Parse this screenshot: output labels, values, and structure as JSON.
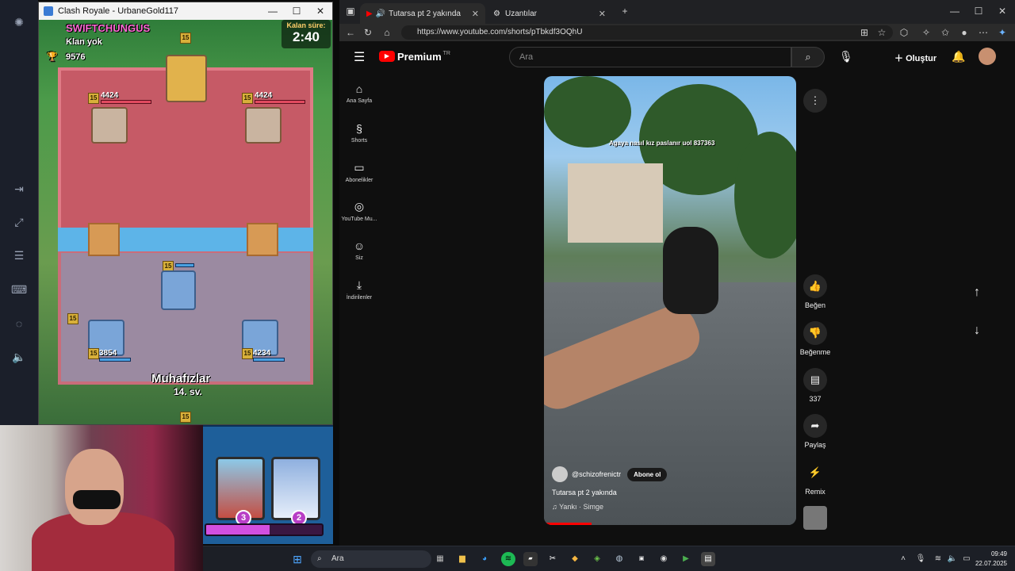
{
  "game": {
    "window_title": "Clash Royale - UrbaneGold117",
    "opponent_name": "SWIFTCHUNGUS",
    "opponent_clan": "Klan yok",
    "opponent_trophies": "9576",
    "timer_label": "Kalan süre:",
    "timer_value": "2:40",
    "king_level": "15",
    "enemy_left_hp": "4424",
    "enemy_right_hp": "4424",
    "enemy_left_level": "15",
    "enemy_right_level": "15",
    "own_king_level": "15",
    "own_left_hp": "3854",
    "own_right_hp": "4234",
    "own_left_level": "15",
    "own_right_level": "15",
    "unit_level": "15",
    "own_king_bottom_level": "15",
    "unit_label_line1": "Muhafızlar",
    "unit_label_line2": "14. sv.",
    "card1_cost": "3",
    "card2_cost": "2",
    "elixir_fraction": 0.55,
    "colors": {
      "enemy_lane": "#c65a66",
      "own_lane": "#9b8aa1",
      "river": "#5db4e8"
    }
  },
  "browser": {
    "tabs": [
      {
        "label": "Tutarsa pt 2 yakında - YouTube",
        "active": true
      },
      {
        "label": "Uzantılar",
        "active": false
      }
    ],
    "url": "https://www.youtube.com/shorts/pTbkdf3OQhU",
    "new_tab_symbol": "+"
  },
  "youtube": {
    "logo_text": "Premium",
    "logo_region": "TR",
    "search_placeholder": "Ara",
    "create_label": "Oluştur",
    "sidebar": [
      {
        "label": "Ana Sayfa",
        "icon": "home-icon"
      },
      {
        "label": "Shorts",
        "icon": "shorts-icon"
      },
      {
        "label": "Abonelikler",
        "icon": "subscriptions-icon"
      },
      {
        "label": "YouTube Mu...",
        "icon": "youtube-music-icon"
      },
      {
        "label": "Siz",
        "icon": "user-icon"
      },
      {
        "label": "İndirilenler",
        "icon": "download-icon"
      }
    ],
    "short": {
      "overlay_text": "Agaya nasıl kız paslanır uol 837363",
      "channel": "@schizofrenictr",
      "subscribe_label": "Abone ol",
      "title": "Tutarsa pt 2 yakında",
      "audio": "Yankı · Simge"
    },
    "actions": {
      "like_label": "Beğen",
      "dislike_label": "Beğenme",
      "comments_count": "337",
      "share_label": "Paylaş",
      "remix_label": "Remix"
    },
    "brand_color": "#ff0000"
  },
  "taskbar": {
    "search_placeholder": "Ara",
    "time": "09:49",
    "date": "22.07.2025"
  }
}
